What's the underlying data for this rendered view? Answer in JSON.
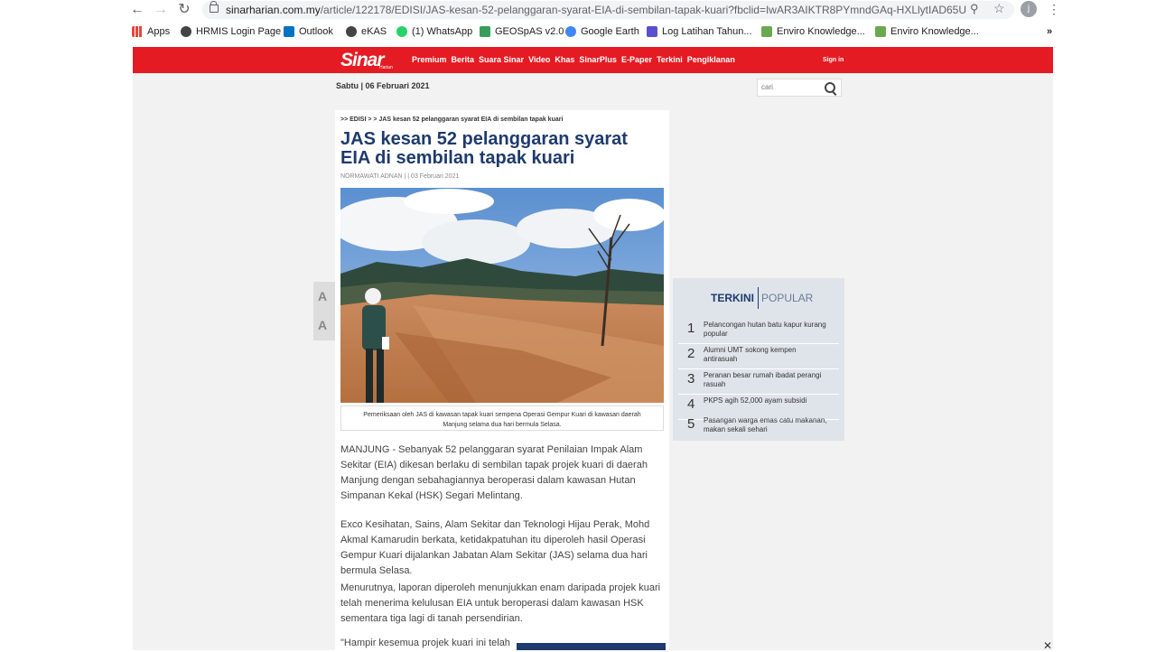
{
  "browser": {
    "url_host": "sinarharian.com.my",
    "url_path": "/article/122178/EDISI/JAS-kesan-52-pelanggaran-syarat-EIA-di-sembilan-tapak-kuari?fbclid=IwAR3AIKTR8PYmndGAq-HXLlytIAD65U8pxpc...",
    "profile_initial": "j",
    "bookmarks": [
      {
        "label": "Apps",
        "color": "#e8453c"
      },
      {
        "label": "HRMIS Login Page",
        "color": "#444444"
      },
      {
        "label": "Outlook",
        "color": "#0072c6"
      },
      {
        "label": "eKAS",
        "color": "#444444"
      },
      {
        "label": "(1) WhatsApp",
        "color": "#25d366"
      },
      {
        "label": "GEOSpAS v2.0",
        "color": "#3a9d5d"
      },
      {
        "label": "Google Earth",
        "color": "#4285f4"
      },
      {
        "label": "Log Latihan Tahun...",
        "color": "#5a4fcf"
      },
      {
        "label": "Enviro Knowledge...",
        "color": "#6aa84f"
      },
      {
        "label": "Enviro Knowledge...",
        "color": "#6aa84f"
      }
    ]
  },
  "site": {
    "logo": "Sinar",
    "logo_sub": "Harian",
    "nav": [
      "Premium",
      "Berita",
      "Suara Sinar",
      "Video",
      "Khas",
      "SinarPlus",
      "E-Paper",
      "Terkini",
      "Pengiklanan"
    ],
    "signin": "Sign in",
    "date": "Sabtu | 06 Februari 2021",
    "search_placeholder": "cari",
    "brand_color": "#e41b23"
  },
  "article": {
    "breadcrumb": ">> EDISI > > JAS kesan 52 pelanggaran syarat EIA di sembilan tapak kuari",
    "title": "JAS kesan 52 pelanggaran syarat EIA di sembilan tapak kuari",
    "byline": "NORMAWATI ADNAN | | 03 Februari 2021",
    "caption": "Pemeriksaan oleh JAS di kawasan tapak kuari sempena Operasi Gempur Kuari di kawasan daerah Manjung selama dua hari bermula Selasa.",
    "paragraphs": [
      "MANJUNG - Sebanyak 52 pelanggaran syarat Penilaian Impak Alam Sekitar (EIA) dikesan berlaku di sembilan tapak projek kuari di daerah Manjung dengan sebahagiannya beroperasi dalam kawasan Hutan Simpanan Kekal (HSK) Segari Melintang.",
      "Exco Kesihatan, Sains, Alam Sekitar dan Teknologi Hijau Perak, Mohd Akmal Kamarudin berkata, ketidakpatuhan itu diperoleh hasil Operasi Gempur Kuari dijalankan Jabatan Alam Sekitar (JAS) selama dua hari bermula Selasa.",
      "Menurutnya, laporan diperoleh menunjukkan enam daripada projek kuari telah menerima kelulusan EIA untuk beroperasi dalam kawasan HSK sementara tiga lagi di tanah persendirian.",
      "\"Hampir kesemua projek kuari ini telah"
    ],
    "font_controls": [
      "A",
      "A"
    ]
  },
  "sidebar": {
    "tab_active": "TERKINI",
    "tab_inactive": "POPULAR",
    "items": [
      {
        "num": "1",
        "text": "Pelancongan hutan batu kapur kurang popular"
      },
      {
        "num": "2",
        "text": "Alumni UMT sokong kempen antirasuah"
      },
      {
        "num": "3",
        "text": "Peranan besar rumah ibadat perangi rasuah"
      },
      {
        "num": "4",
        "text": "PKPS agih 52,000 ayam subsidi"
      },
      {
        "num": "5",
        "text": "Pasangan warga emas catu makanan, makan sekali sehari"
      }
    ]
  }
}
